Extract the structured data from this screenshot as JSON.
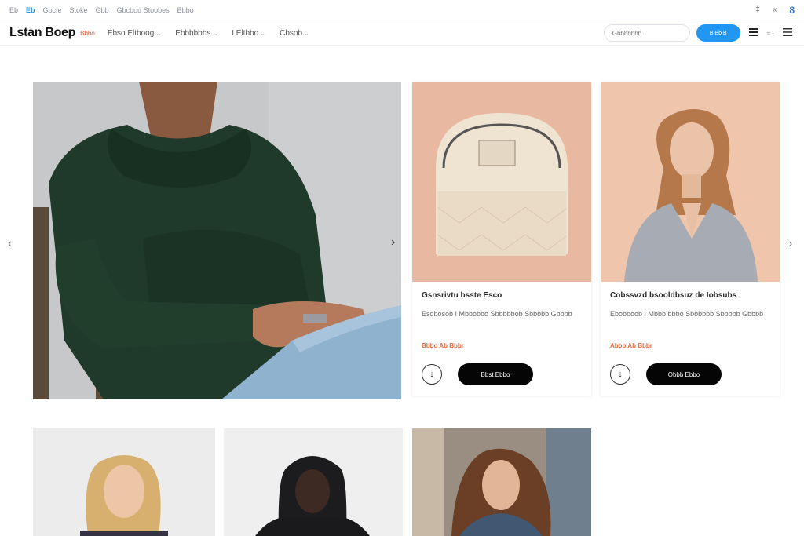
{
  "utility_bar": {
    "links": [
      "Eb",
      "Eb",
      "Gbcfe",
      "Stoke",
      "Gbb",
      "Gbcbod Stoobes",
      "Bbbo"
    ],
    "active_index": 1,
    "right": [
      "‡",
      "«",
      "8"
    ]
  },
  "nav": {
    "logo": "Lstan Boep",
    "logo_tag": "Bbbo",
    "menu": [
      "Ebso Eltboog",
      "Ebbbbbbs",
      "I Eltbbo",
      "Cbsob"
    ],
    "search_placeholder": "Gbbbbbbb",
    "cta_label": "B Bb B",
    "right_extra": "≈ ·"
  },
  "hero": {
    "image": "person-in-green-hoodie"
  },
  "cards": [
    {
      "image": "quilted-cream-bag",
      "title": "Gsnsrivtu bsste Esco",
      "desc": "Esdbosob I Mbbobbo Sbbbbbob Sbbbbb Gbbbb",
      "price": "Bbbo Ab Bbbr",
      "buy_label": "Bbst Ebbo",
      "icon_label": "↓"
    },
    {
      "image": "woman-grey-cardigan",
      "title": "Cobssvzd bsooldbsuz de Iobsubs",
      "desc": "Ebobboob I Mbbb bbbo Sbbbbbb Sbbbbb Gbbbb",
      "price": "Abbb Ab Bbbr",
      "buy_label": "Obbb Ebbo",
      "icon_label": "↓"
    }
  ],
  "tiles": [
    {
      "image": "blonde-woman-portrait"
    },
    {
      "image": "man-in-black-hood"
    },
    {
      "image": "woman-denim-jacket"
    }
  ],
  "colors": {
    "accent": "#2196f3",
    "price": "#e06a3a",
    "buy_button": "#050505"
  }
}
